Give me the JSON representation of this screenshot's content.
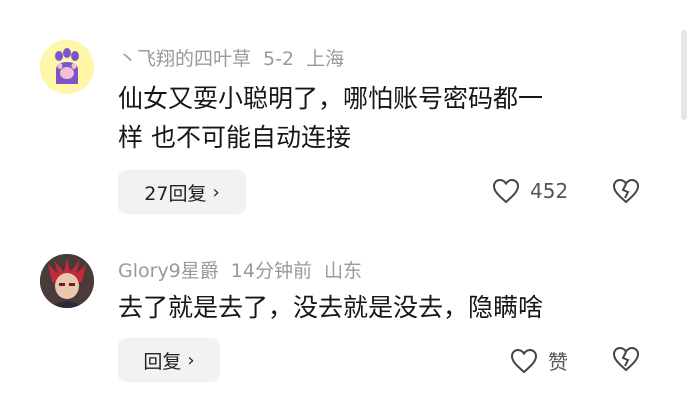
{
  "comments": [
    {
      "username": "丶飞翔的四叶草",
      "date": "5-2",
      "location": "上海",
      "text_line1": "仙女又耍小聪明了，哪怕账号密码都一",
      "text_line2": "样 也不可能自动连接",
      "reply_label": "27回复",
      "like_count": "452",
      "avatar_icon": "cat-paw-icon"
    },
    {
      "username": "Glory9星爵",
      "date": "14分钟前",
      "location": "山东",
      "text_line1": "去了就是去了，没去就是没去，隐瞒啥",
      "text_line2": "",
      "reply_label": "回复",
      "like_count": "赞",
      "avatar_icon": "anime-character-avatar"
    }
  ],
  "colors": {
    "meta": "#9a9a9a",
    "text": "#161616",
    "reply_bg": "#f2f2f2"
  }
}
